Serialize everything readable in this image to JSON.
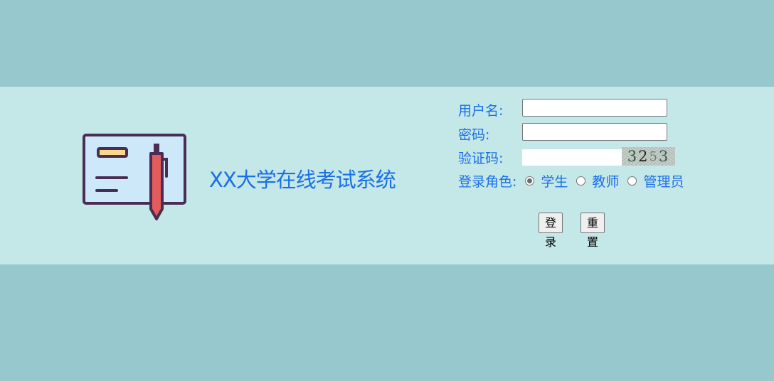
{
  "header": {
    "title": "XX大学在线考试系统"
  },
  "form": {
    "username_label": "用户名:",
    "username_value": "",
    "password_label": "密码:",
    "password_value": "",
    "captcha_label": "验证码:",
    "captcha_value": "",
    "captcha_digits": [
      "3",
      "2",
      "5",
      "3"
    ],
    "role_label": "登录角色:",
    "roles": [
      {
        "label": "学生",
        "checked": true
      },
      {
        "label": "教师",
        "checked": false
      },
      {
        "label": "管理员",
        "checked": false
      }
    ],
    "login_label": "登录",
    "reset_label": "重置"
  },
  "colors": {
    "background": "#97c8ce",
    "band": "#c4e7e8",
    "accent_text": "#1a6fe8"
  }
}
